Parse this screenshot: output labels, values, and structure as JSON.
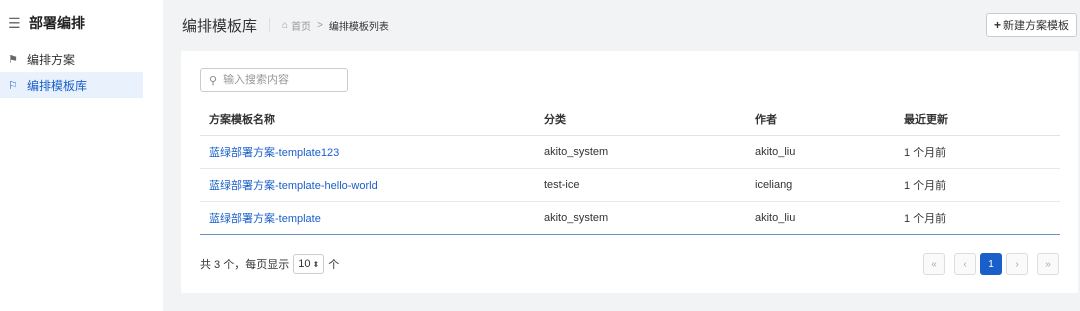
{
  "sidebar": {
    "title": "部署编排",
    "items": [
      {
        "label": "编排方案"
      },
      {
        "label": "编排模板库"
      }
    ]
  },
  "header": {
    "title": "编排模板库",
    "breadcrumb": {
      "home": "首页",
      "separator": ">",
      "current": "编排模板列表"
    },
    "new_button": "新建方案模板"
  },
  "search": {
    "placeholder": "输入搜索内容",
    "value": ""
  },
  "table": {
    "columns": [
      "方案模板名称",
      "分类",
      "作者",
      "最近更新"
    ],
    "rows": [
      {
        "name": "蓝绿部署方案-template123",
        "category": "akito_system",
        "author": "akito_liu",
        "updated": "1 个月前"
      },
      {
        "name": "蓝绿部署方案-template-hello-world",
        "category": "test-ice",
        "author": "iceliang",
        "updated": "1 个月前"
      },
      {
        "name": "蓝绿部署方案-template",
        "category": "akito_system",
        "author": "akito_liu",
        "updated": "1 个月前"
      }
    ]
  },
  "footer": {
    "total_text": "共 3 个，每页显示",
    "page_size": "10",
    "unit": "个"
  },
  "pagination": {
    "first": "«",
    "prev": "‹",
    "current_page": "1",
    "next": "›",
    "last": "»"
  },
  "colors": {
    "accent": "#1a5fc9",
    "active_bg": "#e8f1fc"
  }
}
